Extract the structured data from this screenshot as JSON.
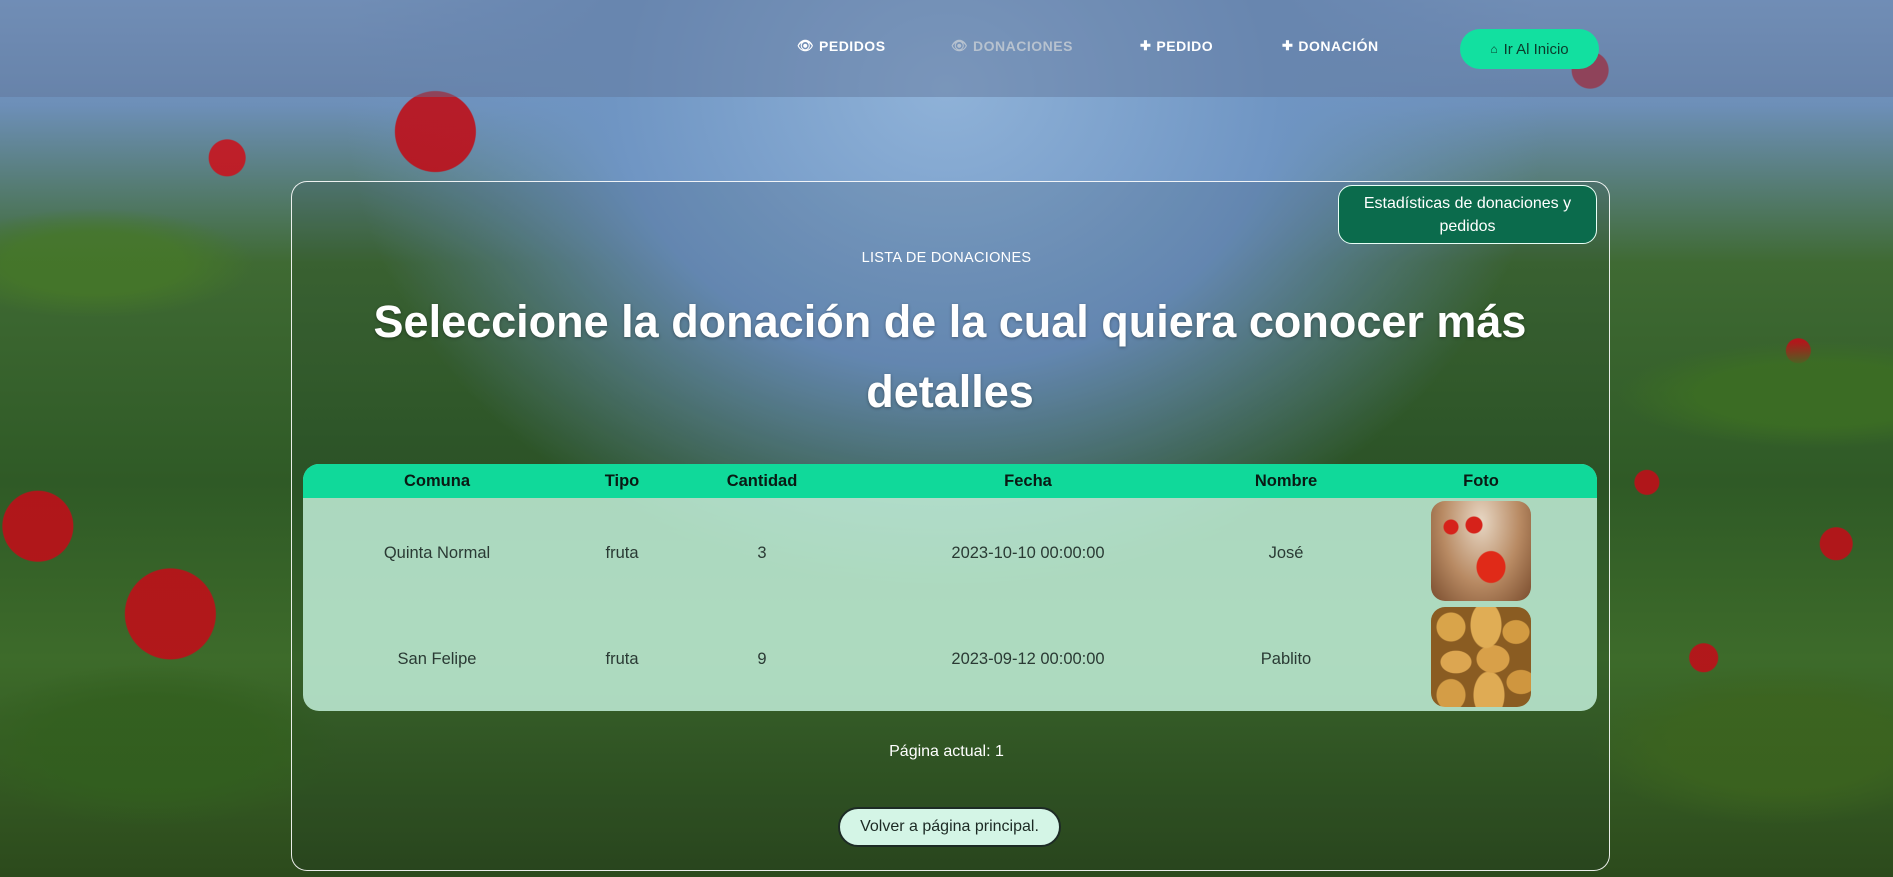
{
  "nav": {
    "items": [
      {
        "label": "PEDIDOS",
        "icon": "eye-icon"
      },
      {
        "label": "DONACIONES",
        "icon": "eye-icon"
      },
      {
        "label": "PEDIDO",
        "icon": "plus-icon"
      },
      {
        "label": "DONACIÓN",
        "icon": "plus-icon"
      }
    ],
    "home_label": "Ir Al Inicio",
    "home_icon": "home-icon"
  },
  "stats_button": "Estadísticas de donaciones y pedidos",
  "eyebrow": "LISTA DE DONACIONES",
  "heading": "Seleccione la donación de la cual quiera conocer más detalles",
  "table": {
    "headers": [
      "Comuna",
      "Tipo",
      "Cantidad",
      "Fecha",
      "Nombre",
      "Foto"
    ],
    "rows": [
      {
        "comuna": "Quinta Normal",
        "tipo": "fruta",
        "cantidad": "3",
        "fecha": "2023-10-10 00:00:00",
        "nombre": "José",
        "foto": "tomato-photo"
      },
      {
        "comuna": "San Felipe",
        "tipo": "fruta",
        "cantidad": "9",
        "fecha": "2023-09-12 00:00:00",
        "nombre": "Pablito",
        "foto": "potato-photo"
      }
    ]
  },
  "page_label": "Página actual: 1",
  "back_button": "Volver a página principal.",
  "colors": {
    "accent": "#10d99a",
    "stats_button_bg": "#0b6b4c",
    "table_body_bg": "#c8f5e1"
  }
}
